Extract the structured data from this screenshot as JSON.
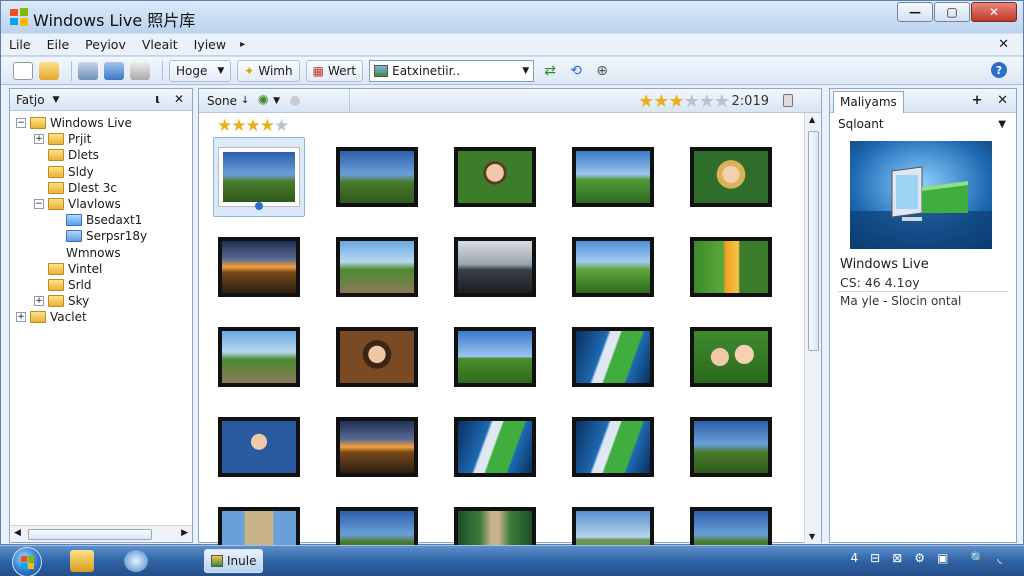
{
  "window": {
    "title": "Windows Live 照片库",
    "controls": [
      "—",
      "▢",
      "✕"
    ]
  },
  "menu": {
    "items": [
      "Lile",
      "Eile",
      "Peyiov",
      "Vleait",
      "Iyiew"
    ],
    "more": "▸",
    "close": "✕"
  },
  "toolbar": {
    "hoge_label": "Hoge",
    "wmn_label": "Wimh",
    "wert_label": "Wert",
    "dropdown_value": "Eatxinetiir..",
    "help_label": "?"
  },
  "left_pane": {
    "title": "Fatjo",
    "controls": [
      "ι",
      "✕"
    ],
    "tree": [
      {
        "label": "Windows Live",
        "depth": 0,
        "expander": "⊟",
        "color": "yellow"
      },
      {
        "label": "Prjit",
        "depth": 1,
        "expander": "⊞",
        "color": "yellow"
      },
      {
        "label": "Dlets",
        "depth": 1,
        "expander": "",
        "color": "yellow"
      },
      {
        "label": "Sldy",
        "depth": 1,
        "expander": "",
        "color": "yellow"
      },
      {
        "label": "Dlest 3c",
        "depth": 1,
        "expander": "",
        "color": "yellow"
      },
      {
        "label": "Vlavlows",
        "depth": 1,
        "expander": "⊟",
        "color": "yellow"
      },
      {
        "label": "Bsedaxt1",
        "depth": 2,
        "expander": "",
        "color": "blue"
      },
      {
        "label": "Serpsr18y",
        "depth": 2,
        "expander": "",
        "color": "blue"
      },
      {
        "label": "Wmnows",
        "depth": 2,
        "expander": "",
        "color": "none"
      },
      {
        "label": "Vintel",
        "depth": 1,
        "expander": "",
        "color": "yellow"
      },
      {
        "label": "Srld",
        "depth": 1,
        "expander": "",
        "color": "yellow"
      },
      {
        "label": "Sky",
        "depth": 1,
        "expander": "⊞",
        "color": "yellow"
      },
      {
        "label": "Vaclet",
        "depth": 0,
        "expander": "⊞",
        "color": "yellow"
      }
    ]
  },
  "main_pane": {
    "sort_label": "Sone",
    "rating_stars": 3,
    "date": "2:019",
    "filter_stars": 4,
    "thumbnails": [
      {
        "scene": "landscape-dusk",
        "selected": true
      },
      {
        "scene": "landscape-dusk"
      },
      {
        "scene": "portrait-green"
      },
      {
        "scene": "meadow-red"
      },
      {
        "scene": "portrait-blond"
      },
      {
        "scene": "sunset"
      },
      {
        "scene": "road-person"
      },
      {
        "scene": "lake-mono"
      },
      {
        "scene": "person-field"
      },
      {
        "scene": "orange-object"
      },
      {
        "scene": "road-person"
      },
      {
        "scene": "portrait-brown"
      },
      {
        "scene": "meadow"
      },
      {
        "scene": "monitor-blue"
      },
      {
        "scene": "portrait-couple"
      },
      {
        "scene": "child-blue"
      },
      {
        "scene": "sunset"
      },
      {
        "scene": "monitor-blue"
      },
      {
        "scene": "monitor-blue"
      },
      {
        "scene": "landscape-dusk"
      },
      {
        "scene": "building"
      },
      {
        "scene": "landscape-dusk"
      },
      {
        "scene": "path-trees"
      },
      {
        "scene": "hills-sky"
      },
      {
        "scene": "landscape-dusk"
      }
    ]
  },
  "right_pane": {
    "tab_label": "Maliyams",
    "controls": [
      "+",
      "✕"
    ],
    "select_label": "Sqloant",
    "info_title": "Windows Live",
    "info_detail": "CS: 46 4.1oy",
    "info_detail2": "Ma yle - Slocin ontal"
  },
  "taskbar": {
    "active_button_label": "Inule",
    "tray_icons": [
      "4",
      "⊟",
      "⊠",
      "⚙",
      "▣",
      "🔍",
      "◟"
    ]
  }
}
